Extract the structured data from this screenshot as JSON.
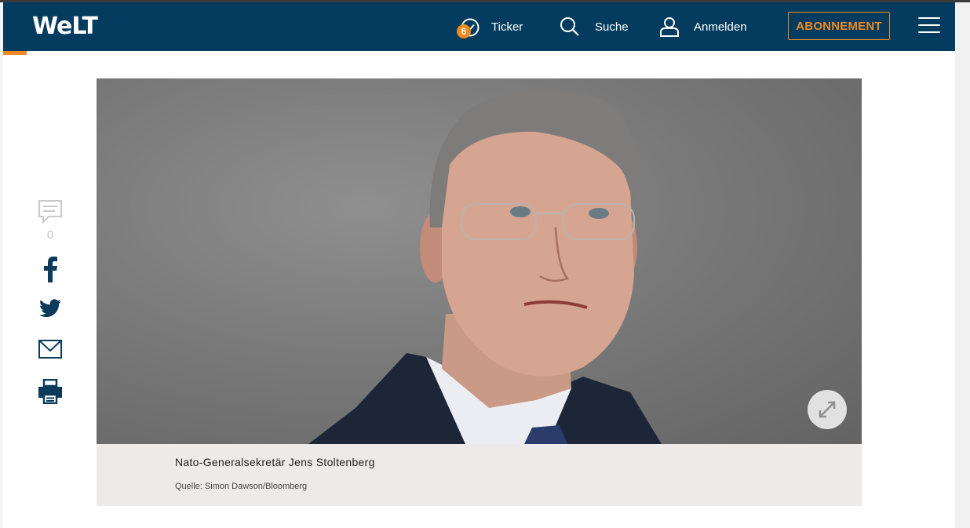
{
  "header": {
    "logo": "WeLT",
    "ticker": {
      "label": "Ticker",
      "badge": "6"
    },
    "search": {
      "label": "Suche"
    },
    "login": {
      "label": "Anmelden"
    },
    "subscription": {
      "label": "ABONNEMENT"
    }
  },
  "share": {
    "comment_count": "0",
    "icons": [
      "comment-icon",
      "facebook-icon",
      "twitter-icon",
      "mail-icon",
      "print-icon"
    ]
  },
  "figure": {
    "caption": "Nato-Generalsekretär Jens Stoltenberg",
    "source": "Quelle: Simon Dawson/Bloomberg"
  },
  "colors": {
    "header_bg": "#033c5e",
    "accent": "#ef8a21",
    "icon": "#0b3a5a",
    "caption_bg": "#ecebe9"
  }
}
